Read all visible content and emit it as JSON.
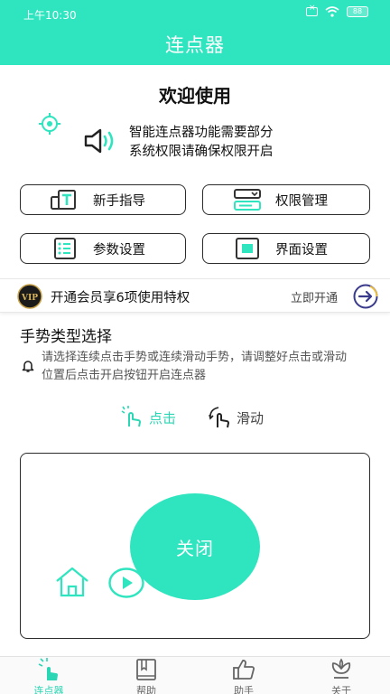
{
  "status": {
    "time": "上午10:30",
    "battery": "88"
  },
  "header": {
    "title": "连点器"
  },
  "welcome": "欢迎使用",
  "notice": {
    "line1": "智能连点器功能需要部分",
    "line2": "系统权限请确保权限开启"
  },
  "buttons": [
    {
      "label": "新手指导",
      "icon": "guide-icon"
    },
    {
      "label": "权限管理",
      "icon": "permission-icon"
    },
    {
      "label": "参数设置",
      "icon": "list-icon"
    },
    {
      "label": "界面设置",
      "icon": "screen-icon"
    }
  ],
  "vip": {
    "badge": "VIP",
    "text": "开通会员享6项使用特权",
    "action": "立即开通"
  },
  "gesture": {
    "title": "手势类型选择",
    "hint": "请选择连续点击手势或连续滑动手势，请调整好点击或滑动位置后点击开启按钮开启连点器",
    "click_label": "点击",
    "slide_label": "滑动"
  },
  "panel": {
    "close_label": "关闭"
  },
  "tabs": [
    {
      "label": "连点器",
      "icon": "tap-icon",
      "active": true
    },
    {
      "label": "帮助",
      "icon": "book-icon",
      "active": false
    },
    {
      "label": "助手",
      "icon": "thumbs-up-icon",
      "active": false
    },
    {
      "label": "关于",
      "icon": "flower-icon",
      "active": false
    }
  ],
  "colors": {
    "accent": "#2ee5bf",
    "border": "#2b2b2b"
  }
}
